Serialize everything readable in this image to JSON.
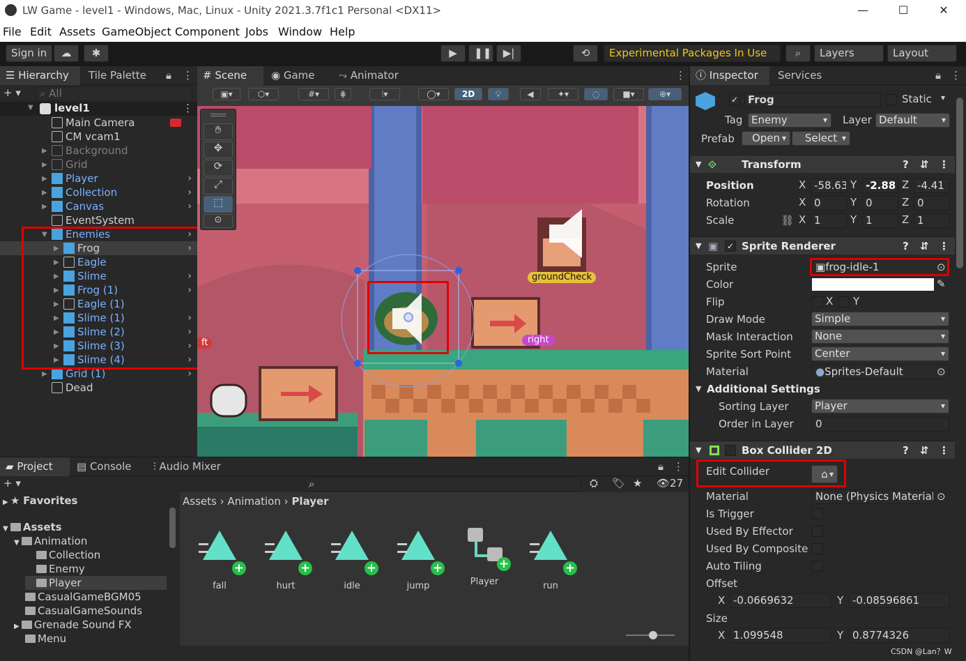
{
  "window": {
    "title": "LW Game - level1 - Windows, Mac, Linux - Unity 2021.3.7f1c1 Personal <DX11>"
  },
  "menu": [
    "File",
    "Edit",
    "Assets",
    "GameObject",
    "Component",
    "Jobs",
    "Window",
    "Help"
  ],
  "toolbar": {
    "sign_in": "Sign in",
    "packages": "Experimental Packages In Use",
    "layers": "Layers",
    "layout": "Layout"
  },
  "hierarchy": {
    "tabs": [
      "Hierarchy",
      "Tile Palette"
    ],
    "search_placeholder": "All",
    "scene": "level1",
    "items": [
      {
        "label": "Main Camera",
        "style": "normal"
      },
      {
        "label": "CM vcam1",
        "style": "normal"
      },
      {
        "label": "Background",
        "style": "gray"
      },
      {
        "label": "Grid",
        "style": "gray"
      },
      {
        "label": "Player",
        "style": "blue"
      },
      {
        "label": "Collection",
        "style": "blue"
      },
      {
        "label": "Canvas",
        "style": "blue"
      },
      {
        "label": "EventSystem",
        "style": "normal"
      },
      {
        "label": "Enemies",
        "style": "blue"
      },
      {
        "label": "Frog",
        "style": "normal"
      },
      {
        "label": "Eagle",
        "style": "blue"
      },
      {
        "label": "Slime",
        "style": "blue"
      },
      {
        "label": "Frog (1)",
        "style": "blue"
      },
      {
        "label": "Eagle (1)",
        "style": "blue"
      },
      {
        "label": "Slime (1)",
        "style": "blue"
      },
      {
        "label": "Slime (2)",
        "style": "blue"
      },
      {
        "label": "Slime (3)",
        "style": "blue"
      },
      {
        "label": "Slime (4)",
        "style": "blue"
      },
      {
        "label": "Grid (1)",
        "style": "blue"
      },
      {
        "label": "Dead",
        "style": "normal"
      }
    ]
  },
  "scene_view": {
    "tabs": [
      "Scene",
      "Game",
      "Animator"
    ],
    "mode_2d": "2D",
    "labels": {
      "ground_check": "groundCheck",
      "right": "right",
      "left_partial": "ft"
    }
  },
  "inspector": {
    "tabs": [
      "Inspector",
      "Services"
    ],
    "object_name": "Frog",
    "static_label": "Static",
    "tag_label": "Tag",
    "tag": "Enemy",
    "layer_label": "Layer",
    "layer": "Default",
    "prefab_label": "Prefab",
    "open": "Open",
    "select": "Select",
    "transform": {
      "title": "Transform",
      "position_label": "Position",
      "position": [
        "-58.63",
        "-2.88",
        "-4.41"
      ],
      "rotation_label": "Rotation",
      "rotation": [
        "0",
        "0",
        "0"
      ],
      "scale_label": "Scale",
      "scale": [
        "1",
        "1",
        "1"
      ],
      "axes": [
        "X",
        "Y",
        "Z"
      ]
    },
    "sprite_renderer": {
      "title": "Sprite Renderer",
      "sprite_label": "Sprite",
      "sprite": "frog-idle-1",
      "color_label": "Color",
      "flip_label": "Flip",
      "flip_x": "X",
      "flip_y": "Y",
      "draw_mode_label": "Draw Mode",
      "draw_mode": "Simple",
      "mask_label": "Mask Interaction",
      "mask": "None",
      "sort_point_label": "Sprite Sort Point",
      "sort_point": "Center",
      "material_label": "Material",
      "material": "Sprites-Default",
      "additional": "Additional Settings",
      "sorting_layer_label": "Sorting Layer",
      "sorting_layer": "Player",
      "order_label": "Order in Layer",
      "order": "0"
    },
    "box_collider": {
      "title": "Box Collider 2D",
      "edit_collider": "Edit Collider",
      "material_label": "Material",
      "material": "None (Physics Material",
      "is_trigger": "Is Trigger",
      "used_by_effector": "Used By Effector",
      "used_by_composite": "Used By Composite",
      "auto_tiling": "Auto Tiling",
      "offset_label": "Offset",
      "offset_x": "-0.0669632",
      "offset_y": "-0.08596861",
      "size_label": "Size",
      "size_x": "1.099548",
      "size_y": "0.8774326"
    }
  },
  "project": {
    "tabs": [
      "Project",
      "Console",
      "Audio Mixer"
    ],
    "favorites": "Favorites",
    "assets_root": "Assets",
    "tree": [
      {
        "label": "Animation",
        "indent": 1
      },
      {
        "label": "Collection",
        "indent": 2
      },
      {
        "label": "Enemy",
        "indent": 2
      },
      {
        "label": "Player",
        "indent": 2
      },
      {
        "label": "CasualGameBGM05",
        "indent": 1
      },
      {
        "label": "CasualGameSounds",
        "indent": 1
      },
      {
        "label": "Grenade Sound FX",
        "indent": 1
      },
      {
        "label": "Menu",
        "indent": 1
      }
    ],
    "breadcrumb": [
      "Assets",
      "Animation",
      "Player"
    ],
    "hidden_count": "27",
    "assets": [
      "fall",
      "hurt",
      "idle",
      "jump",
      "Player",
      "run"
    ]
  },
  "watermark": "CSDN @Lan？W"
}
